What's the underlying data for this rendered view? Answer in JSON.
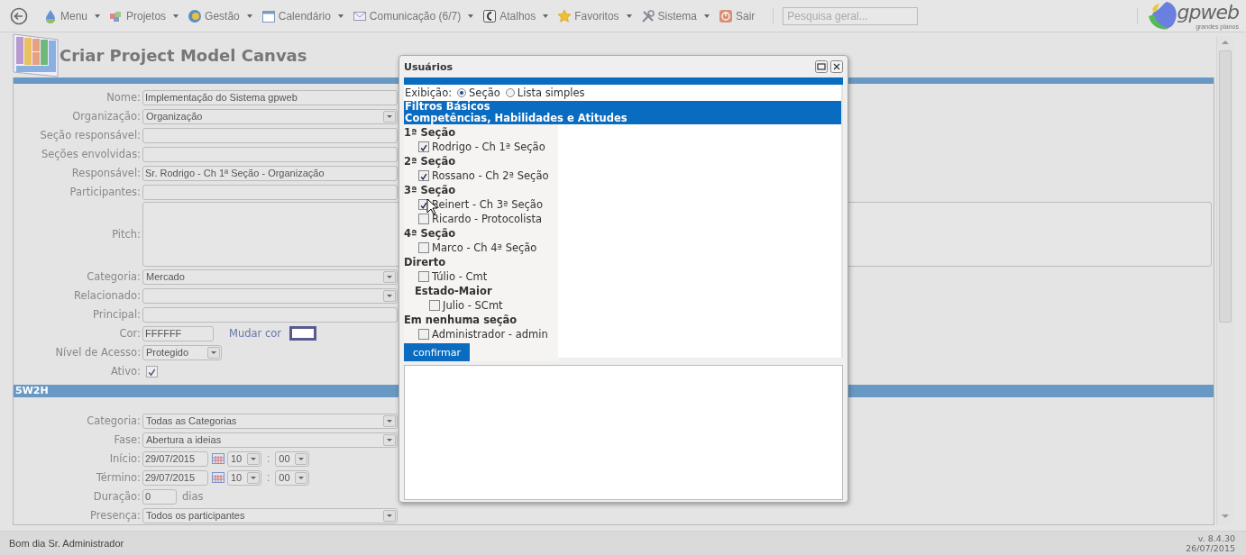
{
  "nav": {
    "items": [
      {
        "label": "Menu",
        "caret": true
      },
      {
        "label": "Projetos",
        "caret": true
      },
      {
        "label": "Gestão",
        "caret": true
      },
      {
        "label": "Calendário",
        "caret": true
      },
      {
        "label": "Comunicação (6/7)",
        "caret": true
      },
      {
        "label": "Atalhos",
        "caret": true
      },
      {
        "label": "Favoritos",
        "caret": true
      },
      {
        "label": "Sistema",
        "caret": true
      },
      {
        "label": "Sair",
        "caret": false
      }
    ],
    "search": {
      "placeholder": "Pesquisa geral..."
    },
    "logo": {
      "name": "gpweb",
      "tagline": "grandes planos"
    }
  },
  "page": {
    "title": "Criar Project Model Canvas",
    "fields": [
      {
        "label": "Nome:",
        "kind": "text",
        "value": "Implementação do Sistema gpweb"
      },
      {
        "label": "Organização:",
        "kind": "select",
        "value": "Organização"
      },
      {
        "label": "Seção responsável:",
        "kind": "text"
      },
      {
        "label": "Seções envolvidas:",
        "kind": "text"
      },
      {
        "label": "Responsável:",
        "kind": "text",
        "value": "Sr. Rodrigo - Ch 1ª Seção - Organização"
      },
      {
        "label": "Participantes:",
        "kind": "text"
      },
      {
        "label": "Pitch:",
        "kind": "textarea"
      },
      {
        "label": "Categoria:",
        "kind": "select",
        "value": "Mercado"
      },
      {
        "label": "Relacionado:",
        "kind": "select"
      },
      {
        "label": "Principal:",
        "kind": "text"
      },
      {
        "label": "Cor:",
        "kind": "color",
        "value": "FFFFFF",
        "link": "Mudar cor"
      },
      {
        "label": "Nível de Acesso:",
        "kind": "select_small",
        "value": "Protegido"
      },
      {
        "label": "Ativo:",
        "kind": "checkbox",
        "checked": true
      }
    ],
    "section": "5W2H",
    "fields2": [
      {
        "label": "Categoria:",
        "kind": "select",
        "value": "Todas as Categorias"
      },
      {
        "label": "Fase:",
        "kind": "select",
        "value": "Abertura a ideias"
      },
      {
        "label": "Início:",
        "kind": "datetime",
        "date": "29/07/2015",
        "hour": "10",
        "separator": ":",
        "minute": "00"
      },
      {
        "label": "Término:",
        "kind": "datetime",
        "date": "29/07/2015",
        "hour": "10",
        "separator": ":",
        "minute": "00"
      },
      {
        "label": "Duração:",
        "kind": "number",
        "value": "0",
        "unit": "dias"
      },
      {
        "label": "Presença:",
        "kind": "select",
        "value": "Todos os participantes"
      }
    ]
  },
  "dialog": {
    "title": "Usuários",
    "display_label": "Exibição:",
    "radios": [
      {
        "label": "Seção",
        "selected": true
      },
      {
        "label": "Lista simples",
        "selected": false
      }
    ],
    "headers": [
      "Filtros Básicos",
      "Competências, Habilidades e Atitudes"
    ],
    "groups": [
      {
        "name": "1ª Seção",
        "users": [
          {
            "name": "Rodrigo - Ch 1ª Seção",
            "checked": true
          }
        ]
      },
      {
        "name": "2ª Seção",
        "users": [
          {
            "name": "Rossano - Ch 2ª Seção",
            "checked": true
          }
        ]
      },
      {
        "name": "3ª Seção",
        "users": [
          {
            "name": "Reinert - Ch 3ª Seção",
            "checked": true
          },
          {
            "name": "Ricardo - Protocolista",
            "checked": false
          }
        ]
      },
      {
        "name": "4ª Seção",
        "users": [
          {
            "name": "Marco - Ch 4ª Seção",
            "checked": false
          }
        ]
      },
      {
        "name": "Direrto",
        "users": [
          {
            "name": "Túlio - Cmt",
            "checked": false
          }
        ],
        "children": [
          {
            "name": "Estado-Maior",
            "users": [
              {
                "name": "Julio - SCmt",
                "checked": false
              }
            ]
          }
        ]
      },
      {
        "name": "Em nenhuma seção",
        "users": [
          {
            "name": "Administrador - admin",
            "checked": false
          }
        ]
      }
    ],
    "confirm": "confirmar"
  },
  "status_bar": {
    "greeting": "Bom dia Sr. Administrador",
    "version": "v. 8.4.30",
    "date": "26/07/2015"
  }
}
